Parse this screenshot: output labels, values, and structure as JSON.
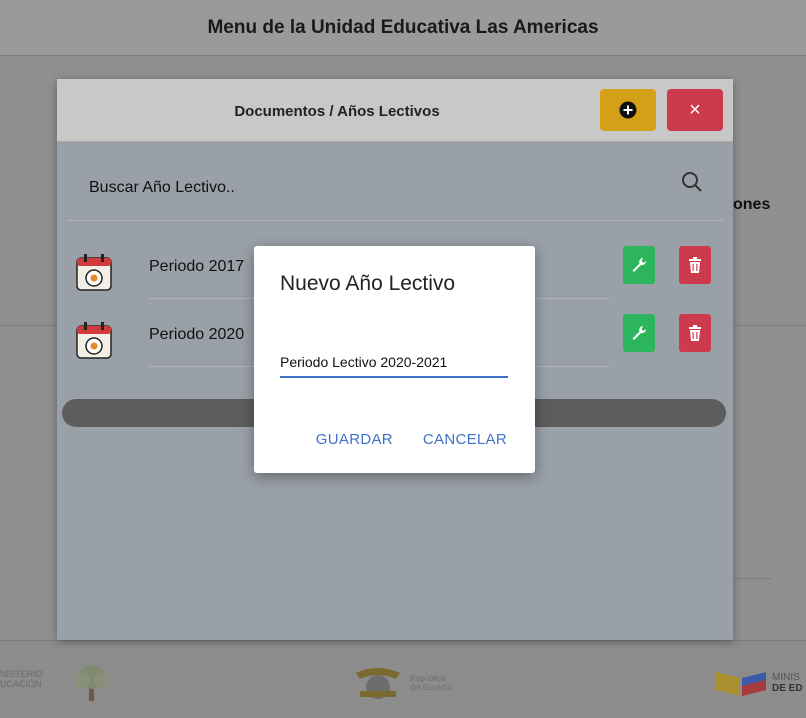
{
  "background": {
    "header_title": "Menu de la Unidad Educativa Las Americas",
    "right_fragment": "ones",
    "footer": {
      "left_text_1": "NISTERIO",
      "left_text_2": "UCACIÓN",
      "center_text_1": "República",
      "center_text_2": "del Ecuador",
      "right_text_1": "MINIS",
      "right_text_2": "DE ED"
    }
  },
  "modal": {
    "title": "Documentos / Años Lectivos",
    "add_icon": "plus-circle-icon",
    "close_label": "×",
    "search_placeholder": "Buscar Año Lectivo..",
    "items": [
      {
        "label": "Periodo 2017",
        "icon": "calendar-icon"
      },
      {
        "label": "Periodo 2020",
        "icon": "calendar-icon"
      }
    ],
    "colors": {
      "add_button": "#d4a017",
      "close_button": "#cc3b4c",
      "edit_button": "#2db55d",
      "delete_button": "#cc3b4c"
    }
  },
  "dialog": {
    "title": "Nuevo Año Lectivo",
    "input_value": "Periodo Lectivo 2020-2021",
    "save_label": "GUARDAR",
    "cancel_label": "CANCELAR",
    "accent": "#3f72c6"
  }
}
